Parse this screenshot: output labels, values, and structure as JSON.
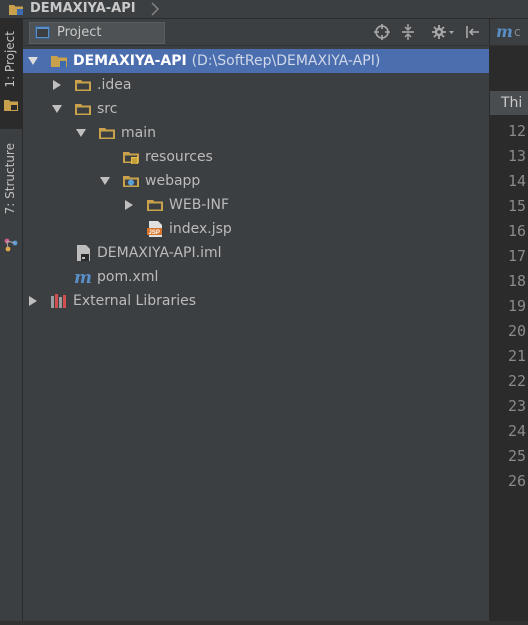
{
  "breadcrumb": {
    "project_name": "DEMAXIYA-API"
  },
  "stripe": {
    "project_label": "1: Project",
    "structure_label": "7: Structure"
  },
  "panel": {
    "view_selector": "Project",
    "tree": [
      {
        "label": "DEMAXIYA-API",
        "path": "(D:\\SoftRep\\DEMAXIYA-API)",
        "icon": "module-folder-icon",
        "expanded": true,
        "selected": true
      },
      {
        "label": ".idea",
        "icon": "folder-icon",
        "expanded": false
      },
      {
        "label": "src",
        "icon": "folder-icon",
        "expanded": true
      },
      {
        "label": "main",
        "icon": "folder-icon",
        "expanded": true
      },
      {
        "label": "resources",
        "icon": "resources-folder-icon"
      },
      {
        "label": "webapp",
        "icon": "web-folder-icon",
        "expanded": true
      },
      {
        "label": "WEB-INF",
        "icon": "folder-icon",
        "expanded": false
      },
      {
        "label": "index.jsp",
        "icon": "jsp-file-icon"
      },
      {
        "label": "DEMAXIYA-API.iml",
        "icon": "iml-file-icon"
      },
      {
        "label": "pom.xml",
        "icon": "maven-icon"
      },
      {
        "label": "External Libraries",
        "icon": "libraries-icon",
        "expanded": false
      }
    ]
  },
  "editor": {
    "tab_text": "c",
    "info_text": "Thi",
    "line_numbers": [
      "12",
      "13",
      "14",
      "15",
      "16",
      "17",
      "18",
      "19",
      "20",
      "21",
      "22",
      "23",
      "24",
      "25",
      "26"
    ]
  },
  "colors": {
    "selection": "#4b6eaf",
    "folder": "#c9a04b",
    "jsp": "#d8752c",
    "maven": "#5a8ec7"
  }
}
